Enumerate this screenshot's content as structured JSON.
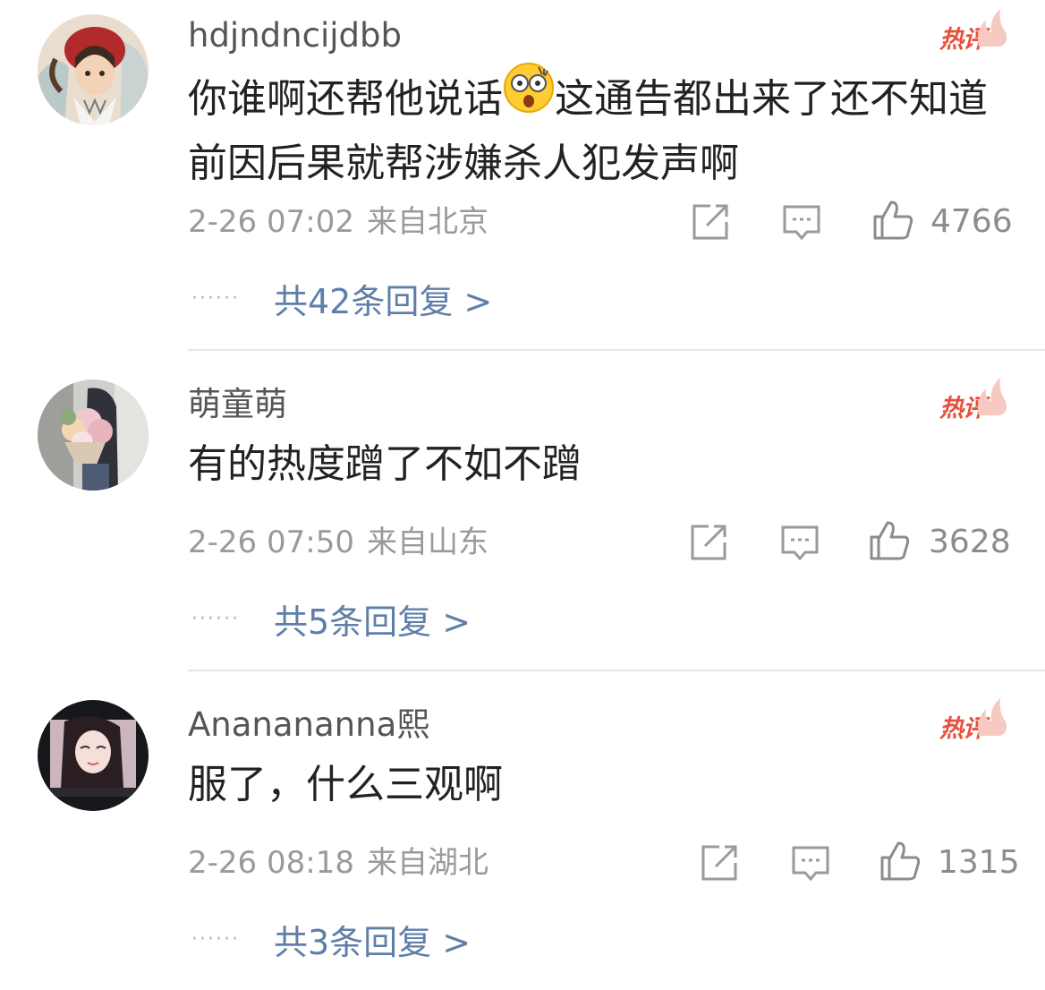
{
  "comments": [
    {
      "username": "hdjndncijdbb",
      "badge": "热评",
      "text_before_emoji": "你谁啊还帮他说话",
      "emoji": "astonished-face",
      "text_after_emoji": "这通告都出来了还不知道前因后果就帮涉嫌杀人犯发声啊",
      "time": "2-26 07:02",
      "location": "来自北京",
      "likes": "4766",
      "replies_label": "共42条回复 >"
    },
    {
      "username": "萌童萌",
      "badge": "热评",
      "text": "有的热度蹭了不如不蹭",
      "time": "2-26 07:50",
      "location": "来自山东",
      "likes": "3628",
      "replies_label": "共5条回复 >"
    },
    {
      "username": "Ananananna熙",
      "badge": "热评",
      "text": "服了，什么三观啊",
      "time": "2-26 08:18",
      "location": "来自湖北",
      "likes": "1315",
      "replies_label": "共3条回复 >"
    }
  ],
  "icons": {
    "share": "share-icon",
    "comment": "comment-icon",
    "like": "thumbs-up-icon",
    "reply_dots": "ellipsis-icon"
  },
  "colors": {
    "hot_badge": "#e8503a",
    "reply_link": "#5e7fa8",
    "meta_text": "#9a9a9a",
    "body_text": "#222222",
    "username": "#555555"
  }
}
